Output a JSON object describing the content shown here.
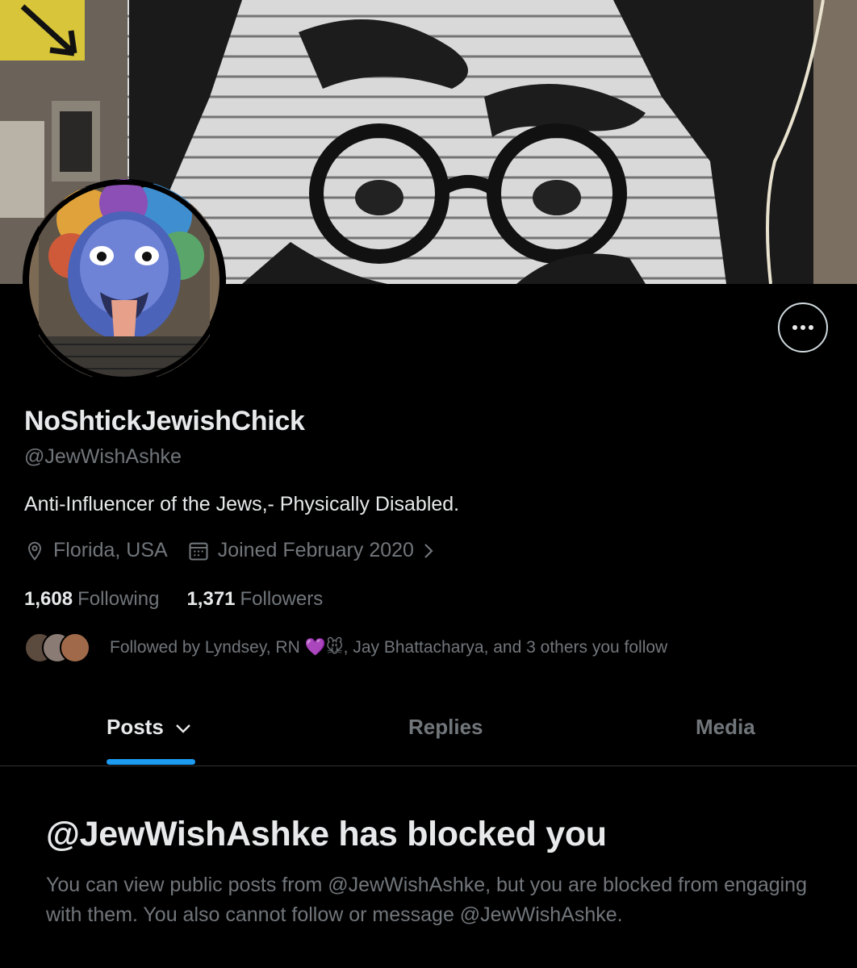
{
  "profile": {
    "display_name": "NoShtickJewishChick",
    "handle": "@JewWishAshke",
    "bio": "Anti-Influencer of the Jews,- Physically Disabled.",
    "location": "Florida, USA",
    "joined": "Joined February 2020",
    "following_count": "1,608",
    "following_label": "Following",
    "followers_count": "1,371",
    "followers_label": "Followers",
    "followed_by": "Followed by Lyndsey, RN 💜🐭, Jay Bhattacharya, and 3 others you follow"
  },
  "tabs": [
    {
      "label": "Posts"
    },
    {
      "label": "Replies"
    },
    {
      "label": "Media"
    }
  ],
  "blocked": {
    "title": "@JewWishAshke has blocked you",
    "body": "You can view public posts from @JewWishAshke, but you are blocked from engaging with them. You also cannot follow or message @JewWishAshke."
  },
  "colors": {
    "background": "#000000",
    "text_primary": "#e7e9ea",
    "text_secondary": "#71767b",
    "accent": "#1d9bf0",
    "divider": "#2f3336"
  }
}
